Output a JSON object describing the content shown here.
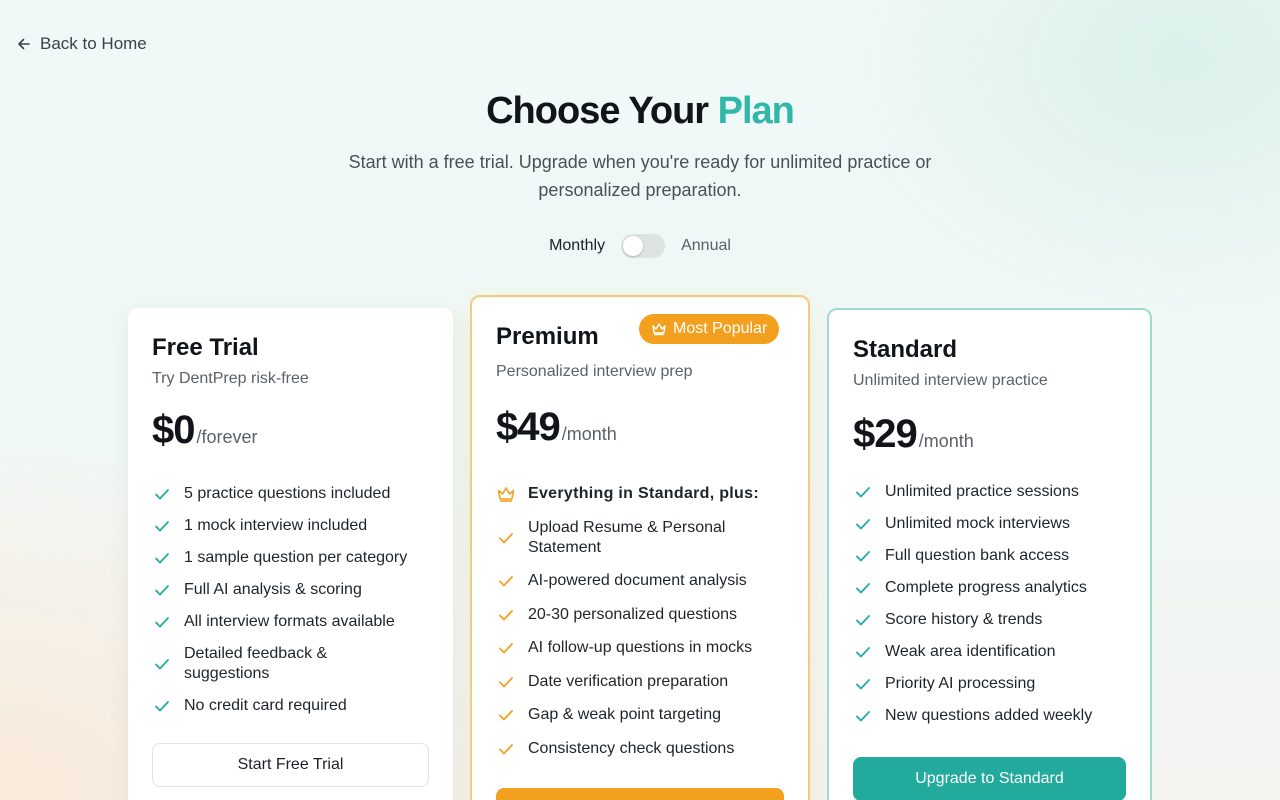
{
  "nav": {
    "back_label": "Back to Home"
  },
  "header": {
    "title_main": "Choose Your",
    "title_accent": "Plan",
    "subtitle": "Start with a free trial. Upgrade when you're ready for unlimited practice or personalized preparation."
  },
  "billing": {
    "monthly_label": "Monthly",
    "annual_label": "Annual",
    "annual_selected": false
  },
  "colors": {
    "accent_teal": "#2fb7aa",
    "premium_orange": "#f2a01e",
    "check_green": "#22ab9c"
  },
  "plans": {
    "free": {
      "name": "Free Trial",
      "description": "Try DentPrep risk-free",
      "price": "$0",
      "period": "/forever",
      "features": [
        "5 practice questions included",
        "1 mock interview included",
        "1 sample question per category",
        "Full AI analysis & scoring",
        "All interview formats available",
        "Detailed feedback & suggestions",
        "No credit card required"
      ],
      "cta": "Start Free Trial"
    },
    "premium": {
      "badge": "Most Popular",
      "name": "Premium",
      "description": "Personalized interview prep",
      "price": "$49",
      "period": "/month",
      "lead_feature": "Everything in Standard, plus:",
      "features": [
        "Upload Resume & Personal Statement",
        "AI-powered document analysis",
        "20-30 personalized questions",
        "AI follow-up questions in mocks",
        "Date verification preparation",
        "Gap & weak point targeting",
        "Consistency check questions"
      ],
      "cta": ""
    },
    "standard": {
      "name": "Standard",
      "description": "Unlimited interview practice",
      "price": "$29",
      "period": "/month",
      "features": [
        "Unlimited practice sessions",
        "Unlimited mock interviews",
        "Full question bank access",
        "Complete progress analytics",
        "Score history & trends",
        "Weak area identification",
        "Priority AI processing",
        "New questions added weekly"
      ],
      "cta": "Upgrade to Standard"
    }
  }
}
